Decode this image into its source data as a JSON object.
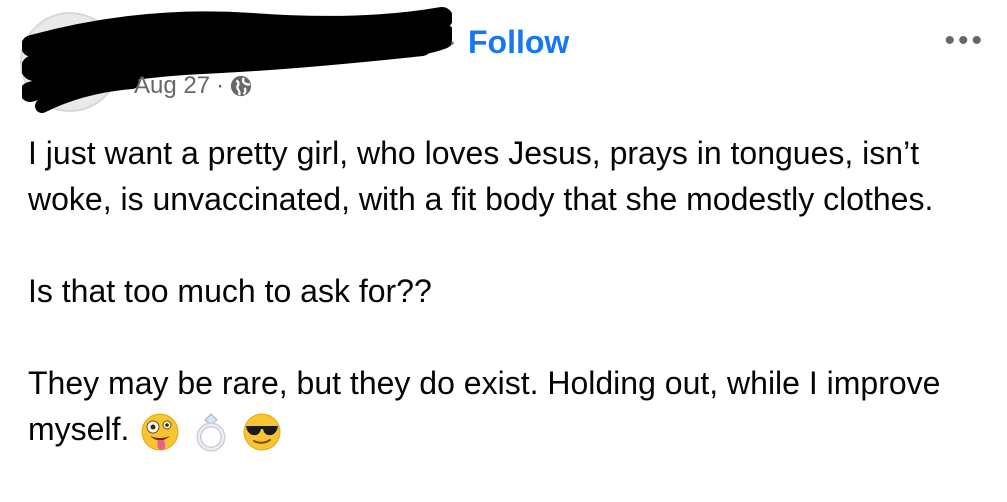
{
  "header": {
    "follow_label": "Follow",
    "more_label": "•••",
    "date": "Aug 27",
    "separator": "·",
    "privacy_icon": "globe-icon"
  },
  "post": {
    "paragraph1": "I just want a pretty girl, who loves Jesus, prays in tongues, isn’t woke, is unvaccinated, with a fit body that she modestly clothes.",
    "paragraph2": "Is that too much to ask for??",
    "paragraph3": "They may be rare, but they do exist. Holding out, while I improve myself.",
    "emojis": [
      "zany-face-emoji",
      "ring-emoji",
      "sunglasses-face-emoji"
    ]
  },
  "colors": {
    "accent": "#1877f2",
    "secondary_text": "#65676b",
    "primary_text": "#050505"
  }
}
